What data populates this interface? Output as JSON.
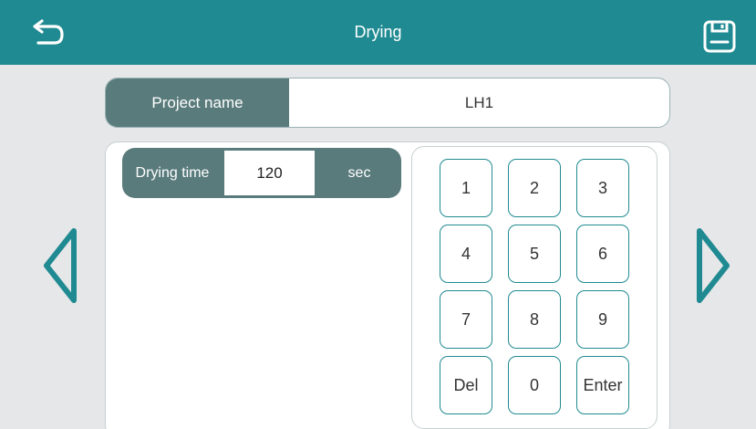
{
  "header": {
    "title": "Drying",
    "back_icon": "back-arrow-icon",
    "save_icon": "floppy-disk-icon",
    "color": "#1f8a91"
  },
  "project": {
    "label": "Project name",
    "value": "LH1"
  },
  "drying_time": {
    "label": "Drying time",
    "value": "120",
    "unit": "sec"
  },
  "keypad": {
    "keys": [
      "1",
      "2",
      "3",
      "4",
      "5",
      "6",
      "7",
      "8",
      "9",
      "Del",
      "0",
      "Enter"
    ]
  },
  "navigation": {
    "prev_icon": "chevron-left-icon",
    "next_icon": "chevron-right-icon"
  },
  "colors": {
    "accent": "#1f8a91",
    "label_bg": "#5a7b7c",
    "background": "#e6e7e9"
  }
}
